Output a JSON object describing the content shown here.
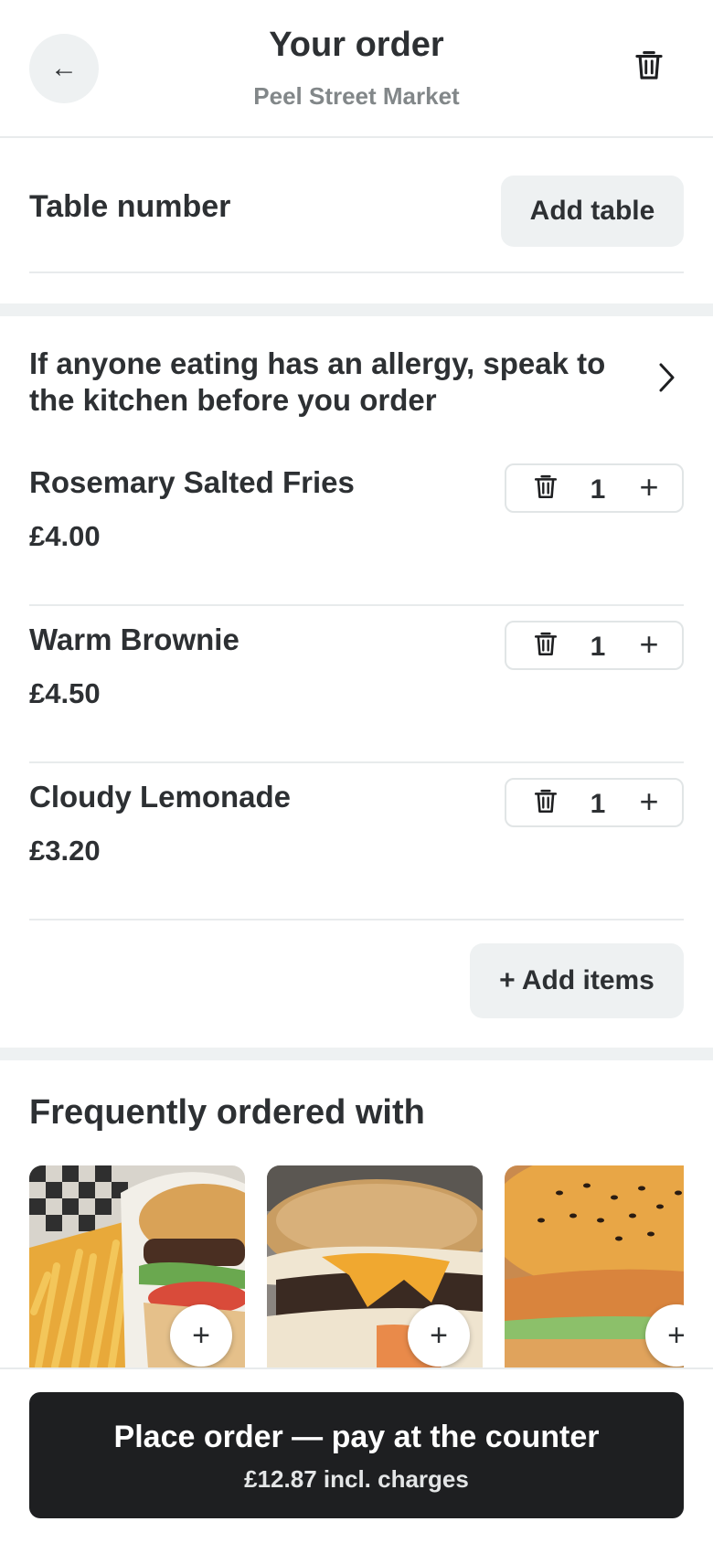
{
  "header": {
    "back_icon": "arrow-left-icon",
    "title": "Your order",
    "subtitle": "Peel Street Market",
    "clear_icon": "trash-icon"
  },
  "table": {
    "label": "Table number",
    "button_label": "Add table"
  },
  "allergy": {
    "text": "If anyone eating has an allergy, speak to the kitchen before you order",
    "icon": "chevron-right-icon"
  },
  "items": [
    {
      "name": "Rosemary Salted Fries",
      "price": "£4.00",
      "qty": "1",
      "plus": "+"
    },
    {
      "name": "Warm Brownie",
      "price": "£4.50",
      "qty": "1",
      "plus": "+"
    },
    {
      "name": "Cloudy Lemonade",
      "price": "£3.20",
      "qty": "1",
      "plus": "+"
    }
  ],
  "add_items_label": "+ Add items",
  "frequently": {
    "title": "Frequently ordered with",
    "cards": [
      {
        "image": "burger-and-fries-photo",
        "add": "+"
      },
      {
        "image": "cheeseburger-photo",
        "add": "+"
      },
      {
        "image": "chicken-burger-photo",
        "add": "+"
      }
    ]
  },
  "footer": {
    "main": "Place order — pay at the counter",
    "sub": "£12.87 incl. charges"
  },
  "colors": {
    "text": "#2d3033",
    "muted": "#828789",
    "surface": "#eef1f2",
    "primary_button": "#1e1f21"
  }
}
